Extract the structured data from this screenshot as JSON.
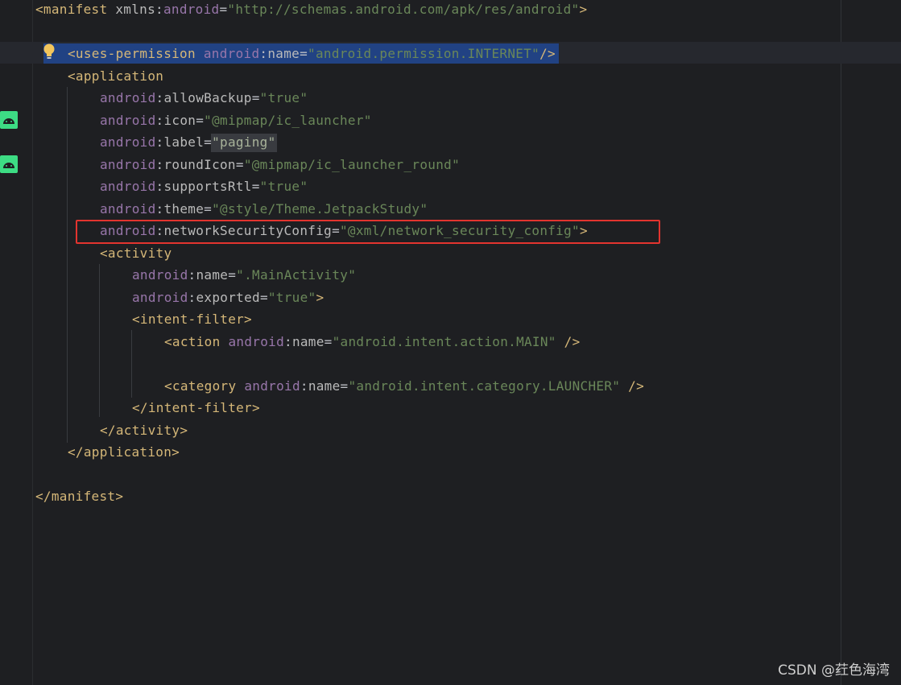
{
  "editor": {
    "file_type": "AndroidManifest.xml",
    "lines": {
      "manifest_open": {
        "tag": "<manifest",
        "ns": "xmlns",
        "colon": ":",
        "attr": "android",
        "eq": "=",
        "value": "\"http://schemas.android.com/apk/res/android\"",
        "close": ">"
      },
      "uses_permission": {
        "tag": "<uses-permission",
        "ns": "android",
        "attr": "name",
        "value": "\"android.permission.INTERNET\"",
        "close": "/>"
      },
      "application_open": {
        "tag": "<application"
      },
      "allow_backup": {
        "ns": "android",
        "attr": "allowBackup",
        "value": "\"true\""
      },
      "icon": {
        "ns": "android",
        "attr": "icon",
        "value": "\"@mipmap/ic_launcher\""
      },
      "label": {
        "ns": "android",
        "attr": "label",
        "value": "\"paging\""
      },
      "round_icon": {
        "ns": "android",
        "attr": "roundIcon",
        "value": "\"@mipmap/ic_launcher_round\""
      },
      "supports_rtl": {
        "ns": "android",
        "attr": "supportsRtl",
        "value": "\"true\""
      },
      "theme": {
        "ns": "android",
        "attr": "theme",
        "value": "\"@style/Theme.JetpackStudy\""
      },
      "network_security_config": {
        "ns": "android",
        "attr": "networkSecurityConfig",
        "value": "\"@xml/network_security_config\"",
        "close": ">"
      },
      "activity_open": {
        "tag": "<activity"
      },
      "activity_name": {
        "ns": "android",
        "attr": "name",
        "value": "\".MainActivity\""
      },
      "activity_exported": {
        "ns": "android",
        "attr": "exported",
        "value": "\"true\"",
        "close": ">"
      },
      "intent_filter_open": {
        "tag": "<intent-filter>"
      },
      "action": {
        "tag": "<action",
        "ns": "android",
        "attr": "name",
        "value": "\"android.intent.action.MAIN\"",
        "close": " />"
      },
      "category": {
        "tag": "<category",
        "ns": "android",
        "attr": "name",
        "value": "\"android.intent.category.LAUNCHER\"",
        "close": " />"
      },
      "intent_filter_close": {
        "tag": "</intent-filter>"
      },
      "activity_close": {
        "tag": "</activity>"
      },
      "application_close": {
        "tag": "</application>"
      },
      "manifest_close": {
        "tag": "</manifest>"
      }
    }
  },
  "watermark": "CSDN @荭色海湾",
  "colors": {
    "background": "#1e1f22",
    "tag": "#d5b778",
    "namespace": "#9876aa",
    "string": "#6a8759",
    "selection": "#214283",
    "highlight_box": "#e3342f",
    "android_icon": "#3ddc84"
  }
}
